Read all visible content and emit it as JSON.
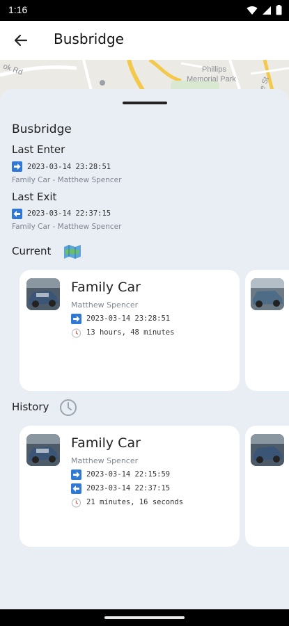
{
  "status_bar": {
    "time": "1:16"
  },
  "app_bar": {
    "title": "Busbridge"
  },
  "map": {
    "labels": [
      "Phillips",
      "Memorial Park",
      "ok Rd",
      "e St"
    ]
  },
  "place": {
    "name": "Busbridge"
  },
  "last_enter": {
    "heading": "Last Enter",
    "timestamp": "2023-03-14 23:28:51",
    "detail": "Family Car - Matthew Spencer"
  },
  "last_exit": {
    "heading": "Last Exit",
    "timestamp": "2023-03-14 22:37:15",
    "detail": "Family Car - Matthew Spencer"
  },
  "current": {
    "heading": "Current",
    "card": {
      "title": "Family Car",
      "owner": "Matthew Spencer",
      "enter": "2023-03-14 23:28:51",
      "duration": "13 hours, 48 minutes"
    }
  },
  "history": {
    "heading": "History",
    "card": {
      "title": "Family Car",
      "owner": "Matthew Spencer",
      "enter": "2023-03-14 22:15:59",
      "exit": "2023-03-14 22:37:15",
      "duration": "21 minutes, 16 seconds"
    }
  },
  "colors": {
    "accent": "#2f78d6",
    "sheet": "#e9edf4"
  }
}
